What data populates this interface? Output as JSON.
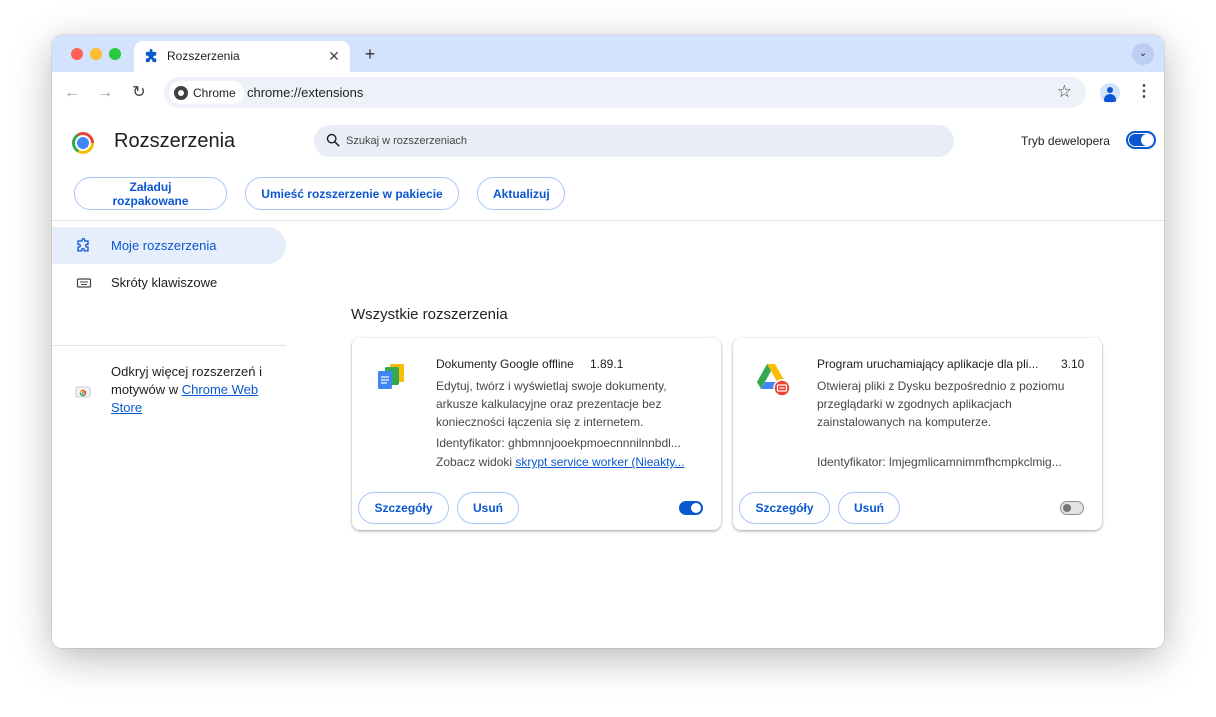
{
  "browser": {
    "tab_title": "Rozszerzenia",
    "chip_label": "Chrome",
    "url": "chrome://extensions"
  },
  "header": {
    "title": "Rozszerzenia",
    "search_placeholder": "Szukaj w rozszerzeniach",
    "dev_mode_label": "Tryb dewelopera",
    "dev_mode_on": true
  },
  "actions": {
    "load_unpacked": "Załaduj rozpakowane",
    "pack": "Umieść rozszerzenie w pakiecie",
    "update": "Aktualizuj"
  },
  "sidebar": {
    "items": [
      {
        "label": "Moje rozszerzenia",
        "icon": "extension-icon",
        "active": true
      },
      {
        "label": "Skróty klawiszowe",
        "icon": "keyboard-icon",
        "active": false
      }
    ],
    "discover_text": "Odkryj więcej rozszerzeń i motywów w ",
    "discover_link": "Chrome Web Store"
  },
  "main": {
    "section_title": "Wszystkie rozszerzenia",
    "extensions": [
      {
        "name": "Dokumenty Google offline",
        "version": "1.89.1",
        "description": "Edytuj, twórz i wyświetlaj swoje dokumenty, arkusze kalkulacyjne oraz prezentacje bez konieczności łączenia się z internetem.",
        "id_label": "Identyfikator: ghbmnnjooekpmoecnnnilnnbdl...",
        "views_label": "Zobacz widoki ",
        "views_link": "skrypt service worker (Nieakty...",
        "details_label": "Szczegóły",
        "remove_label": "Usuń",
        "enabled": true,
        "icon": "google-docs-offline-icon"
      },
      {
        "name": "Program uruchamiający aplikacje dla pli...",
        "version": "3.10",
        "description": "Otwieraj pliki z Dysku bezpośrednio z poziomu przeglądarki w zgodnych aplikacjach zainstalowanych na komputerze.",
        "id_label": "Identyfikator: lmjegmlicamnimmfhcmpkclmig...",
        "details_label": "Szczegóły",
        "remove_label": "Usuń",
        "enabled": false,
        "icon": "google-drive-launcher-icon"
      }
    ]
  },
  "colors": {
    "accent": "#0b57d0",
    "tabstrip": "#d3e3fd",
    "active_nav": "#e7eefb"
  }
}
